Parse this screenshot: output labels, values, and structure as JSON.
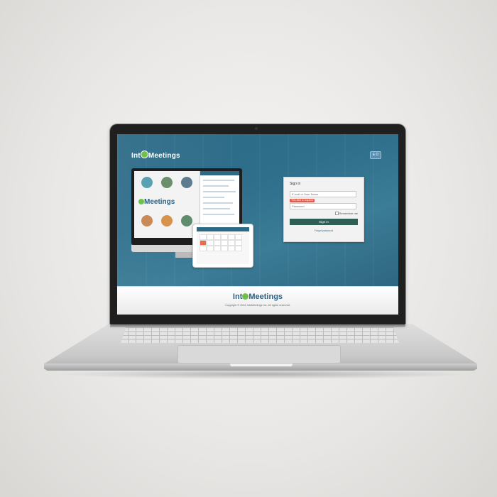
{
  "brand": {
    "logo_prefix": "Int",
    "logo_suffix": "Meetings"
  },
  "header": {
    "lang_label": "E O"
  },
  "signin": {
    "title": "Sign in",
    "username_placeholder": "E-mail or User Name",
    "error": "This field is required",
    "password_placeholder": "Password",
    "remember_label": "Remember me",
    "button_label": "Sign in",
    "forgot_label": "Forgot password"
  },
  "illustration": {
    "logo_prefix": "",
    "logo_suffix": "Meetings"
  },
  "footer": {
    "logo_prefix": "Int",
    "logo_suffix": "Meetings",
    "copyright": "Copyright © 2016 IntoMeetings Inc. All rights reserved."
  },
  "colors": {
    "screen_bg": "#2f6f8c",
    "accent_green": "#6cc24a",
    "signin_button": "#2f5e55",
    "error": "#e35b4a"
  }
}
